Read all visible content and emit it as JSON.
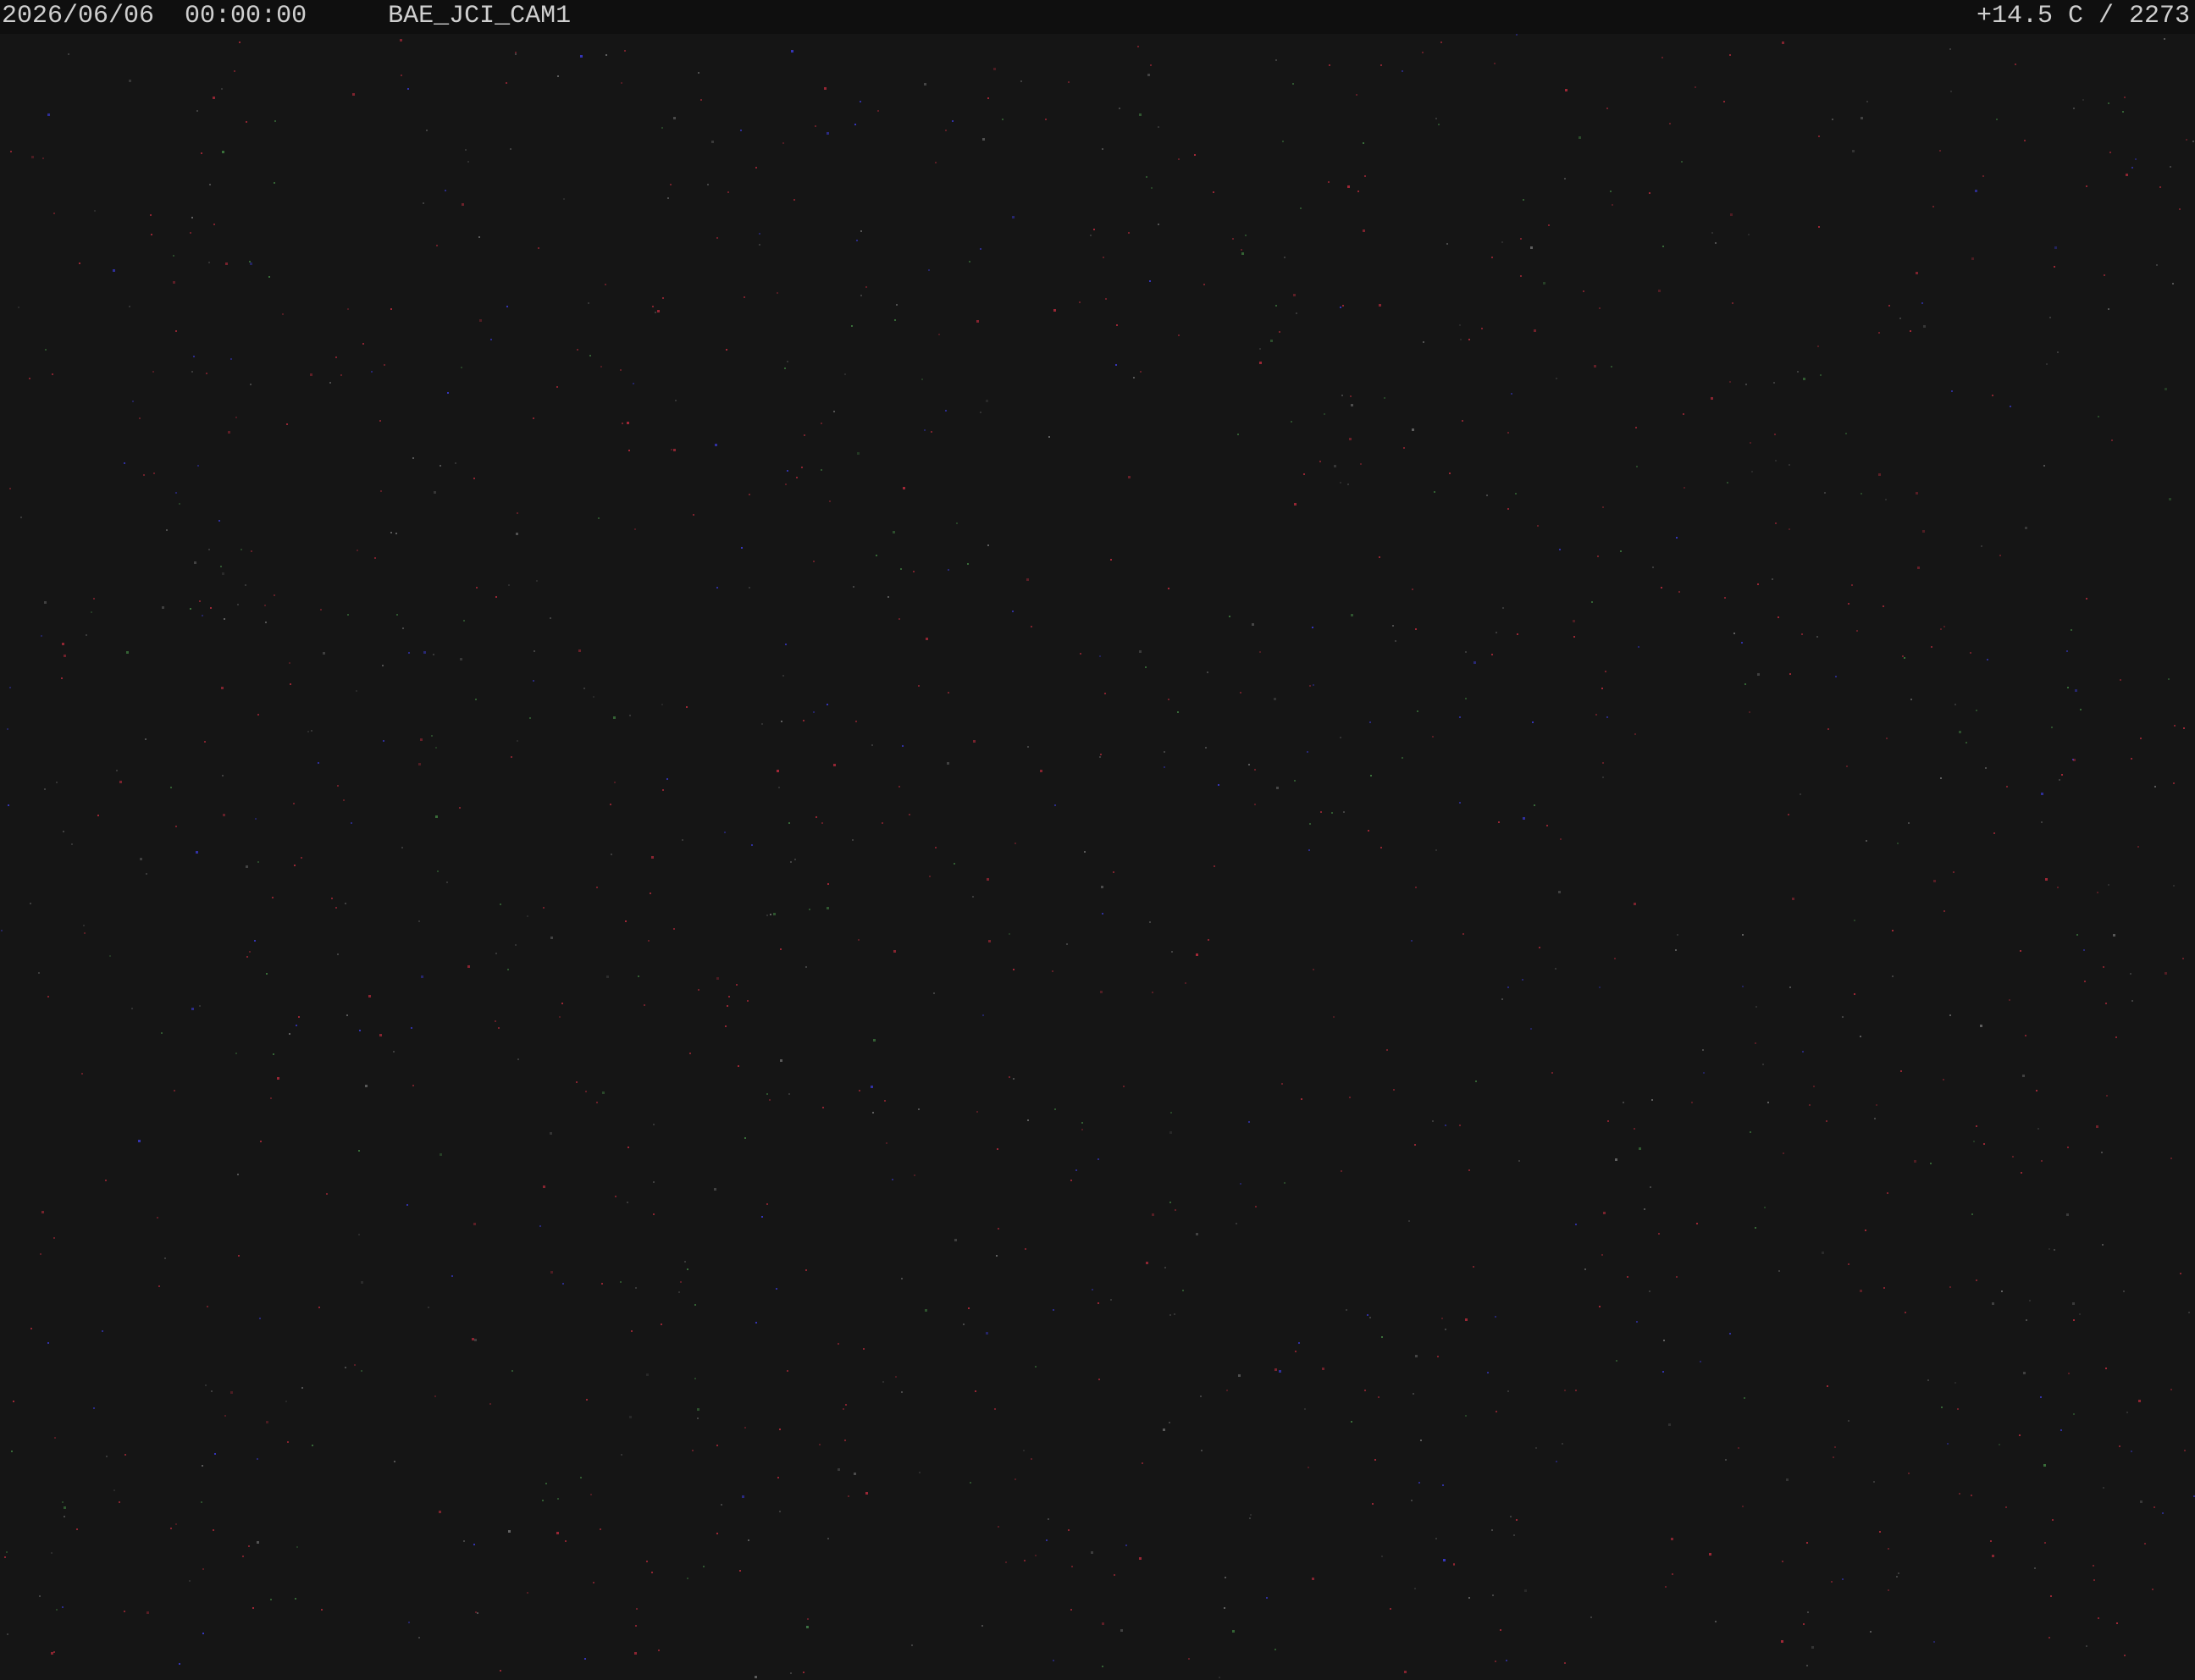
{
  "overlay": {
    "date": "2026/06/06",
    "time": "00:00:00",
    "camera_id": "BAE_JCI_CAM1",
    "sensor_readout": "+14.5 C / 2273"
  },
  "colors": {
    "background": "#151515",
    "overlay_bar": "#0f0f0f",
    "overlay_text": "#cfcfcf",
    "noise_red": "#b02a3a",
    "noise_blue": "#3a3ad0",
    "noise_green": "#3e7a3e"
  }
}
